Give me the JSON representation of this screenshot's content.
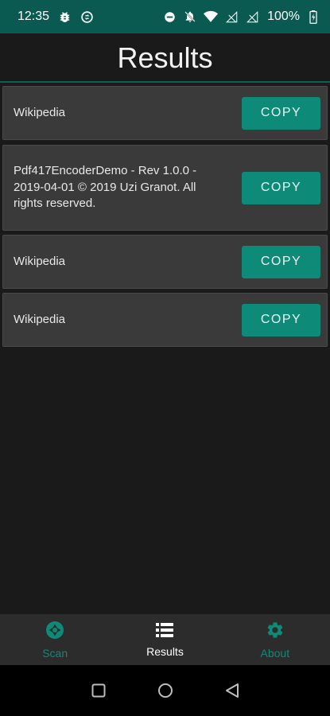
{
  "status_bar": {
    "time": "12:35",
    "battery": "100%",
    "icons": [
      "bug-icon",
      "sync-icon",
      "do-not-disturb-icon",
      "notifications-off-icon",
      "wifi-icon",
      "signal-icon",
      "signal-icon",
      "battery-icon"
    ]
  },
  "header": {
    "title": "Results"
  },
  "results": [
    {
      "text": "Wikipedia",
      "button": "COPY"
    },
    {
      "text": "Pdf417EncoderDemo - Rev 1.0.0 - 2019-04-01 © 2019 Uzi Granot. All rights reserved.",
      "button": "COPY"
    },
    {
      "text": "Wikipedia",
      "button": "COPY"
    },
    {
      "text": "Wikipedia",
      "button": "COPY"
    }
  ],
  "bottom_nav": {
    "items": [
      {
        "label": "Scan",
        "icon": "camera-shutter-icon"
      },
      {
        "label": "Results",
        "icon": "list-icon"
      },
      {
        "label": "About",
        "icon": "gear-icon"
      }
    ]
  },
  "colors": {
    "accent": "#0e8a79",
    "status_bar": "#0b5a52",
    "background": "#1a1a1a",
    "card": "#3a3a3a"
  }
}
